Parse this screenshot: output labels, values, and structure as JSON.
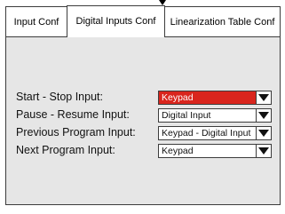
{
  "tabs": [
    {
      "label": "Input Conf"
    },
    {
      "label": "Digital Inputs Conf"
    },
    {
      "label": "Linearization Table Conf"
    }
  ],
  "active_tab": "Digital Inputs Conf",
  "rows": [
    {
      "label": "Start - Stop Input:",
      "value": "Keypad",
      "highlighted": true
    },
    {
      "label": "Pause - Resume Input:",
      "value": "Digital Input",
      "highlighted": false
    },
    {
      "label": "Previous Program Input:",
      "value": "Keypad - Digital Input",
      "highlighted": false
    },
    {
      "label": "Next Program Input:",
      "value": "Keypad",
      "highlighted": false
    }
  ],
  "colors": {
    "panel_bg": "#e6e6e6",
    "highlight": "#d9251d",
    "border": "#3c3c3c"
  },
  "icons": {
    "dropdown": "triangle-down-icon",
    "top_marker": "triangle-down-icon"
  }
}
